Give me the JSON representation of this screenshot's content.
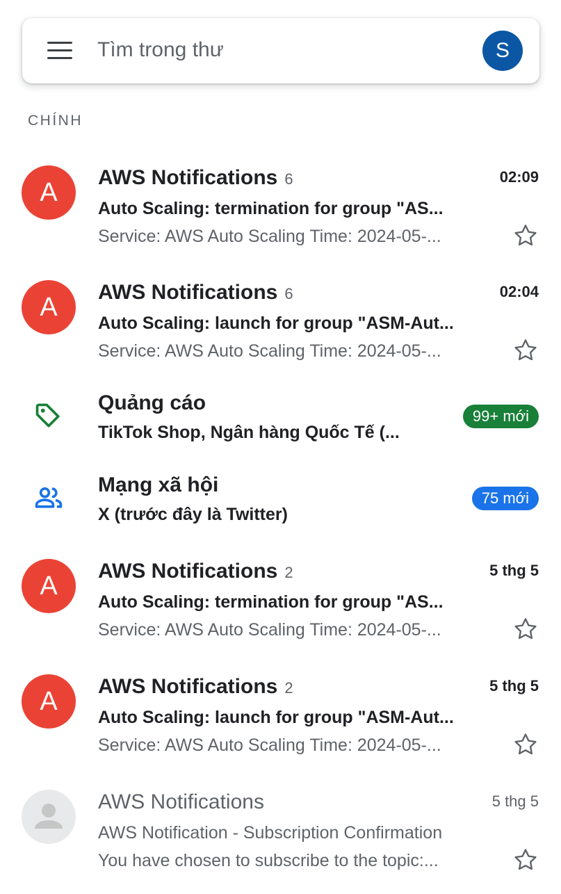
{
  "search": {
    "placeholder": "Tìm trong thư",
    "avatar_letter": "S"
  },
  "section_label": "CHÍNH",
  "emails": [
    {
      "avatar_letter": "A",
      "sender": "AWS Notifications",
      "count": "6",
      "time": "02:09",
      "subject": "Auto Scaling: termination for group \"AS...",
      "snippet": "Service: AWS Auto Scaling Time: 2024-05-...",
      "unread": true,
      "starred": false
    },
    {
      "avatar_letter": "A",
      "sender": "AWS Notifications",
      "count": "6",
      "time": "02:04",
      "subject": "Auto Scaling: launch for group \"ASM-Aut...",
      "snippet": "Service: AWS Auto Scaling Time: 2024-05-...",
      "unread": true,
      "starred": false
    },
    {
      "avatar_letter": "A",
      "sender": "AWS Notifications",
      "count": "2",
      "time": "5 thg 5",
      "subject": "Auto Scaling: termination for group \"AS...",
      "snippet": "Service: AWS Auto Scaling Time: 2024-05-...",
      "unread": true,
      "starred": false
    },
    {
      "avatar_letter": "A",
      "sender": "AWS Notifications",
      "count": "2",
      "time": "5 thg 5",
      "subject": "Auto Scaling: launch for group \"ASM-Aut...",
      "snippet": "Service: AWS Auto Scaling Time: 2024-05-...",
      "unread": true,
      "starred": false
    },
    {
      "avatar_letter": "",
      "sender": "AWS Notifications",
      "count": "",
      "time": "5 thg 5",
      "subject": "AWS Notification - Subscription Confirmation",
      "snippet": "You have chosen to subscribe to the topic:...",
      "unread": false,
      "starred": false
    }
  ],
  "categories": [
    {
      "icon": "tag-icon",
      "title": "Quảng cáo",
      "subtitle": "TikTok Shop, Ngân hàng Quốc Tế (...",
      "badge": "99+ mới",
      "badge_color": "#188038"
    },
    {
      "icon": "people-icon",
      "title": "Mạng xã hội",
      "subtitle": "X (trước đây là Twitter)",
      "badge": "75 mới",
      "badge_color": "#1a73e8"
    }
  ],
  "colors": {
    "avatar_red": "#ea4335",
    "account_avatar": "#0b57a4",
    "tag_icon": "#188038",
    "people_icon": "#1a73e8"
  }
}
